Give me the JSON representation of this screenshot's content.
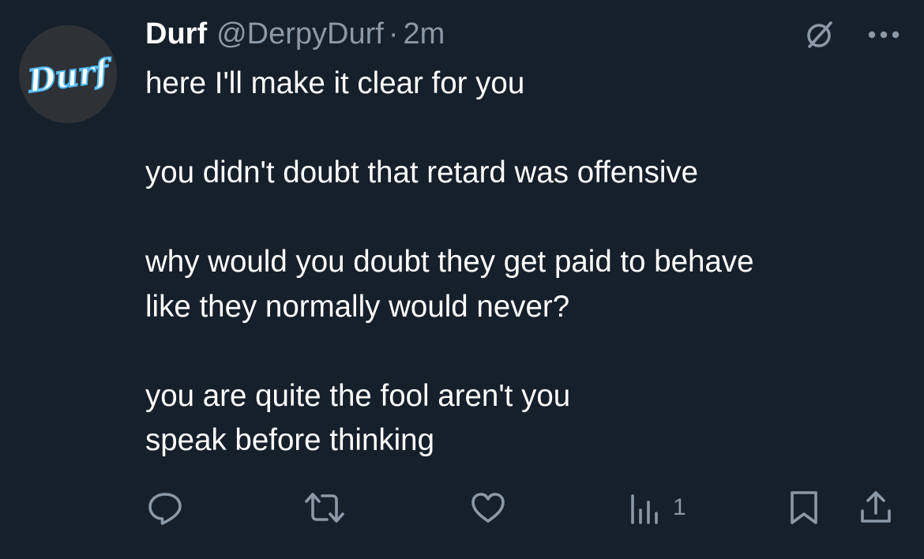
{
  "author": {
    "display_name": "Durf",
    "handle": "@DerpyDurf",
    "separator": "·",
    "time": "2m",
    "avatar_text": "Durf"
  },
  "tweet": {
    "paragraphs": [
      [
        "here I'll make it clear for you"
      ],
      [
        "you didn't doubt that retard was offensive"
      ],
      [
        "why would you doubt they get paid to behave",
        "like they normally would never?"
      ],
      [
        "you are quite the fool aren't you",
        "speak before thinking"
      ]
    ]
  },
  "header_icons": [
    "grok-icon",
    "more-icon"
  ],
  "actions": {
    "reply": {
      "icon": "reply-icon"
    },
    "retweet": {
      "icon": "retweet-icon"
    },
    "like": {
      "icon": "heart-icon"
    },
    "views": {
      "icon": "views-icon",
      "count": "1"
    },
    "bookmark": {
      "icon": "bookmark-icon"
    },
    "share": {
      "icon": "share-icon"
    }
  },
  "colors": {
    "background": "#15202b",
    "text": "#ffffff",
    "secondary": "#8b98a5"
  }
}
